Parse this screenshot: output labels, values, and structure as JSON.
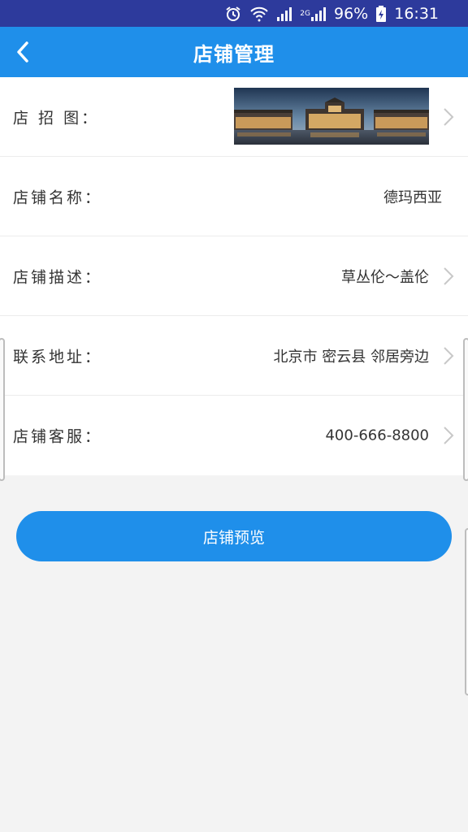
{
  "status_bar": {
    "battery": "96%",
    "time": "16:31",
    "network_label": "2G",
    "icons": [
      "alarm-icon",
      "wifi-icon",
      "signal-icon",
      "signal-2g-icon",
      "battery-charging-icon"
    ]
  },
  "header": {
    "title": "店铺管理",
    "back_icon": "back-chevron-icon"
  },
  "rows": [
    {
      "label": "店 招 图：",
      "value": "",
      "has_chevron": true,
      "type": "image"
    },
    {
      "label": "店铺名称：",
      "value": "德玛西亚",
      "has_chevron": false
    },
    {
      "label": "店铺描述：",
      "value": "草丛伦～盖伦",
      "has_chevron": true
    },
    {
      "label": "联系地址：",
      "value": "北京市 密云县 邻居旁边",
      "has_chevron": true
    },
    {
      "label": "店铺客服：",
      "value": "400-666-8800",
      "has_chevron": true
    }
  ],
  "preview_button": {
    "label": "店铺预览"
  },
  "colors": {
    "status_bar": "#2d3a9c",
    "accent": "#1f8fea",
    "background": "#f3f3f3"
  }
}
